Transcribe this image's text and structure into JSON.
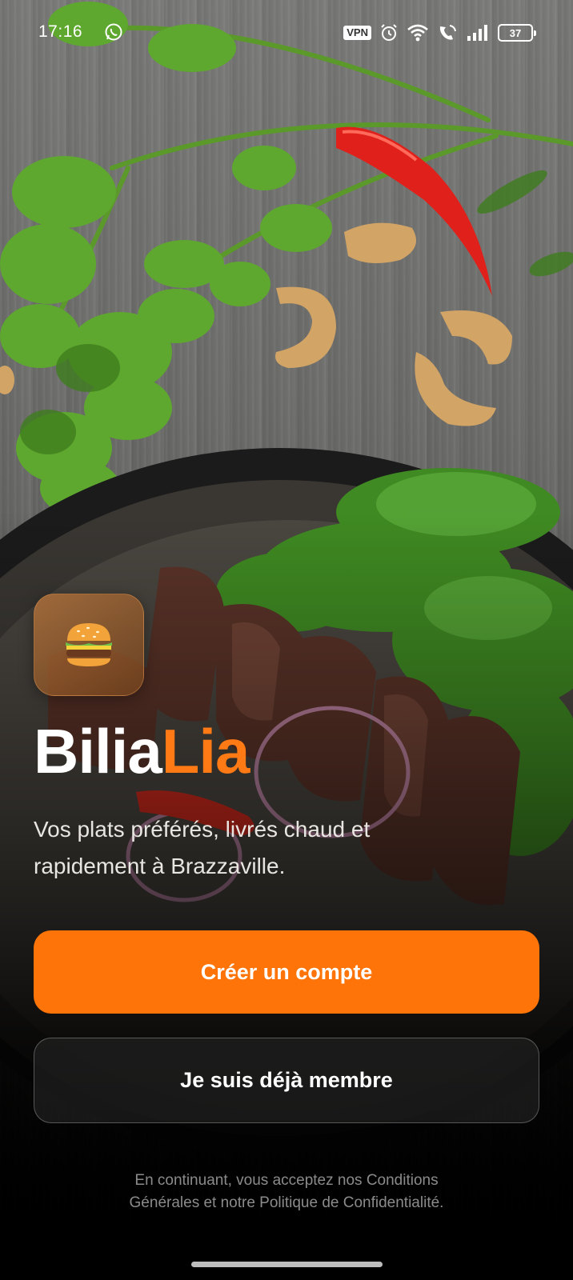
{
  "status_bar": {
    "time": "17:16",
    "vpn_label": "VPN",
    "battery_level": "37",
    "icons": [
      "whatsapp-icon",
      "alarm-icon",
      "wifi-icon",
      "call-signal-icon",
      "cell-signal-icon",
      "battery-icon"
    ]
  },
  "app": {
    "logo_icon": "burger-icon",
    "brand_part_1": "Bilia",
    "brand_part_2": "Lia",
    "brand_color_accent": "#ff7a14",
    "tagline_line_1": "Vos plats préférés, livrés chaud et",
    "tagline_line_2": "rapidement à Brazzaville."
  },
  "actions": {
    "primary_label": "Créer un compte",
    "primary_color": "#ff7408",
    "secondary_label": "Je suis déjà membre"
  },
  "legal": {
    "line_1": "En continuant, vous acceptez nos Conditions",
    "line_2": "Générales et notre Politique de Confidentialité."
  }
}
